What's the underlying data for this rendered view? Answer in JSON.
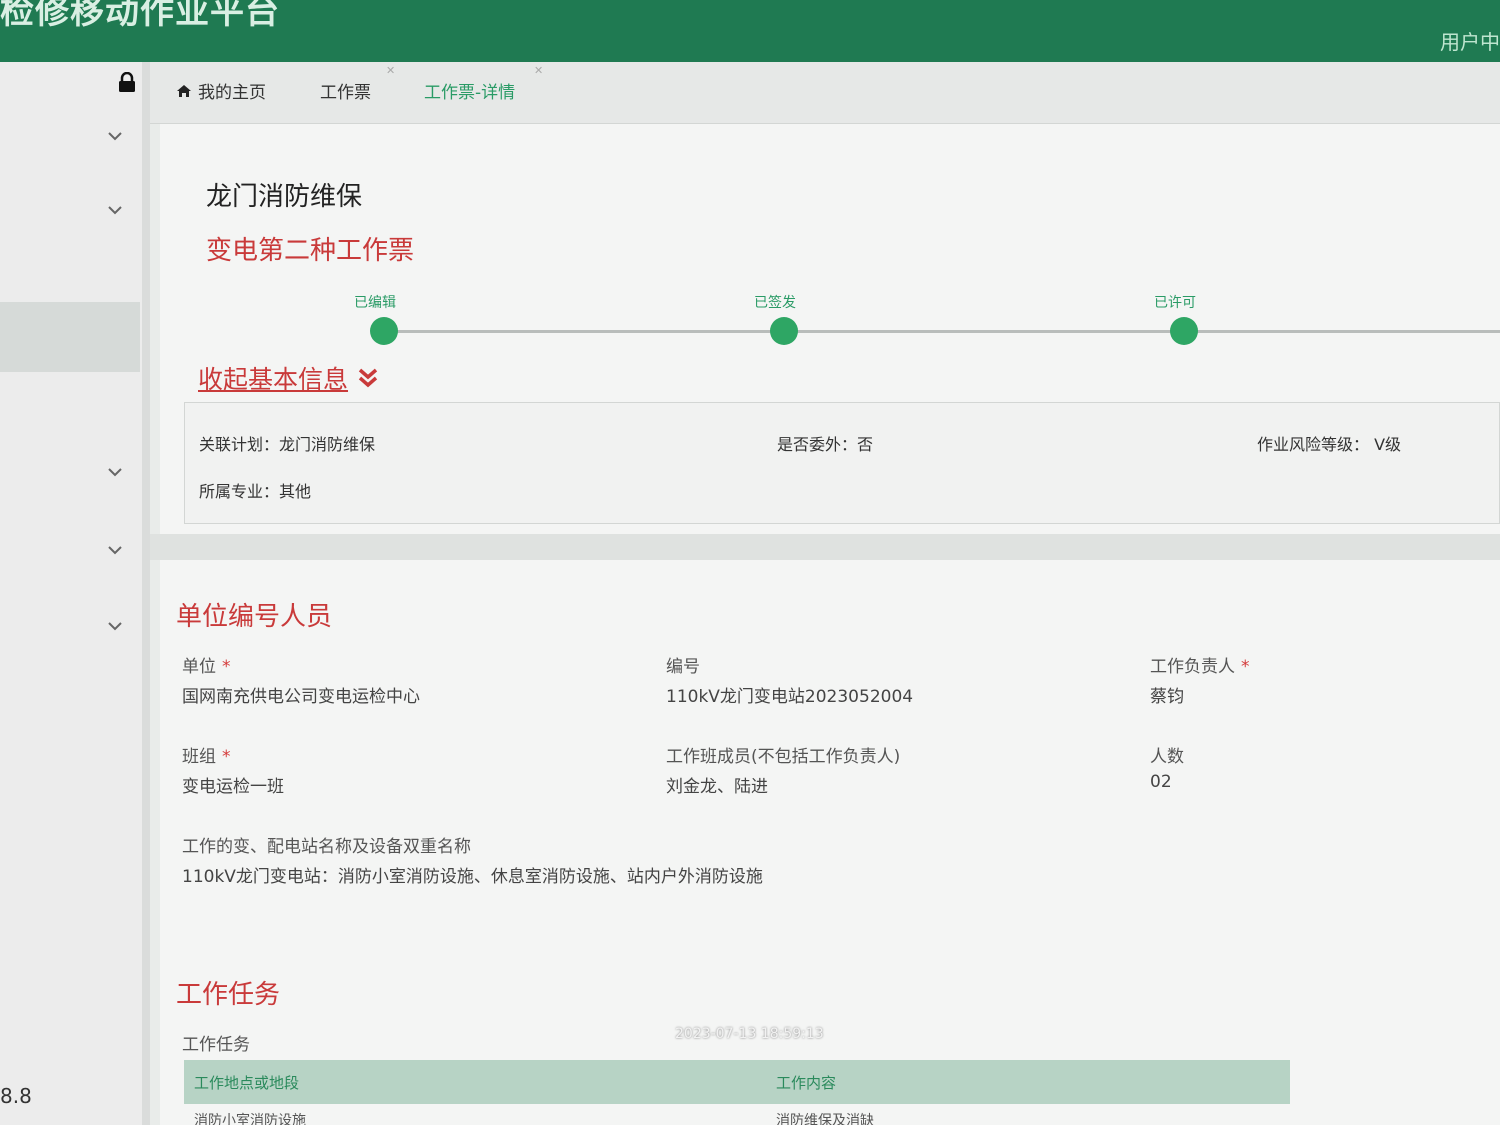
{
  "header": {
    "app_title": "检修移动作业平台",
    "user_center": "用户中"
  },
  "sidebar": {
    "bottom_text": "8.8"
  },
  "tabs": [
    {
      "label": "我的主页",
      "icon": "home-icon"
    },
    {
      "label": "工作票"
    },
    {
      "label": "工作票-详情",
      "active": true
    }
  ],
  "ticket": {
    "project_title": "龙门消防维保",
    "ticket_type": "变电第二种工作票",
    "steps": [
      "已编辑",
      "已签发",
      "已许可"
    ],
    "collapse_label": "收起基本信息"
  },
  "basic_info": {
    "related_plan": "关联计划：龙门消防维保",
    "outsourced": "是否委外：否",
    "risk_level": "作业风险等级： V级",
    "specialty": "所属专业：其他"
  },
  "unit_section": {
    "title": "单位编号人员",
    "unit_label": "单位",
    "unit_value": "国网南充供电公司变电运检中心",
    "number_label": "编号",
    "number_value": "110kV龙门变电站2023052004",
    "leader_label": "工作负责人",
    "leader_value": "蔡钧",
    "team_label": "班组",
    "team_value": "变电运检一班",
    "members_label": "工作班成员(不包括工作负责人)",
    "members_value": "刘金龙、陆进",
    "count_label": "人数",
    "count_value": "02",
    "station_label": "工作的变、配电站名称及设备双重名称",
    "station_value": "110kV龙门变电站：消防小室消防设施、休息室消防设施、站内户外消防设施"
  },
  "task_section": {
    "title": "工作任务",
    "label": "工作任务",
    "col_location": "工作地点或地段",
    "col_content": "工作内容",
    "row1_location": "消防小室消防设施",
    "row1_content": "消防维保及消缺"
  },
  "timestamp": "2023-07-13 18:59:13",
  "colors": {
    "brand_green": "#1f7a52",
    "accent_red": "#c93a3a",
    "step_green": "#2ea664"
  }
}
